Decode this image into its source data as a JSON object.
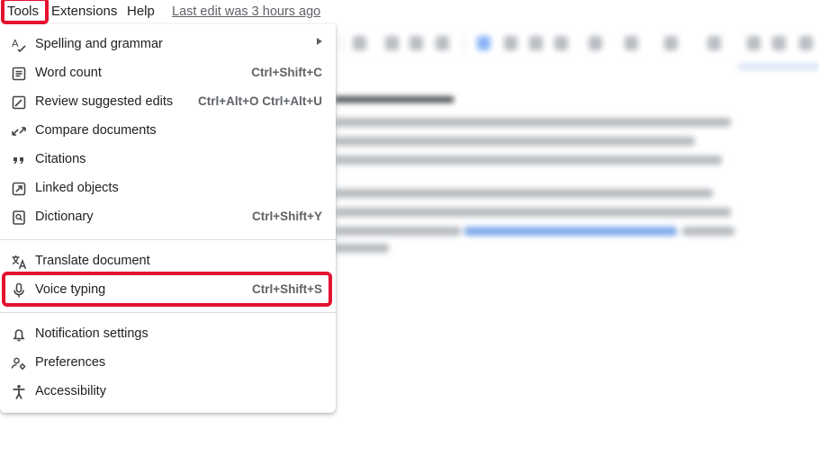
{
  "menubar": {
    "tools": "Tools",
    "extensions": "Extensions",
    "help": "Help",
    "last_edit": "Last edit was 3 hours ago"
  },
  "menu": {
    "items": [
      {
        "label": "Spelling and grammar",
        "shortcut": "",
        "icon": "spellcheck-icon",
        "submenu": true
      },
      {
        "label": "Word count",
        "shortcut": "Ctrl+Shift+C",
        "icon": "word-count-icon"
      },
      {
        "label": "Review suggested edits",
        "shortcut": "Ctrl+Alt+O Ctrl+Alt+U",
        "icon": "review-edits-icon"
      },
      {
        "label": "Compare documents",
        "shortcut": "",
        "icon": "compare-icon"
      },
      {
        "label": "Citations",
        "shortcut": "",
        "icon": "quote-icon"
      },
      {
        "label": "Linked objects",
        "shortcut": "",
        "icon": "linked-objects-icon"
      },
      {
        "label": "Dictionary",
        "shortcut": "Ctrl+Shift+Y",
        "icon": "dictionary-icon"
      },
      {
        "label": "Translate document",
        "shortcut": "",
        "icon": "translate-icon"
      },
      {
        "label": "Voice typing",
        "shortcut": "Ctrl+Shift+S",
        "icon": "microphone-icon",
        "highlighted": true
      },
      {
        "label": "Notification settings",
        "shortcut": "",
        "icon": "bell-icon"
      },
      {
        "label": "Preferences",
        "shortcut": "",
        "icon": "preferences-icon"
      },
      {
        "label": "Accessibility",
        "shortcut": "",
        "icon": "accessibility-icon"
      }
    ]
  },
  "colors": {
    "highlight": "#e5112f",
    "text": "#202124",
    "secondary_text": "#5f6368"
  }
}
